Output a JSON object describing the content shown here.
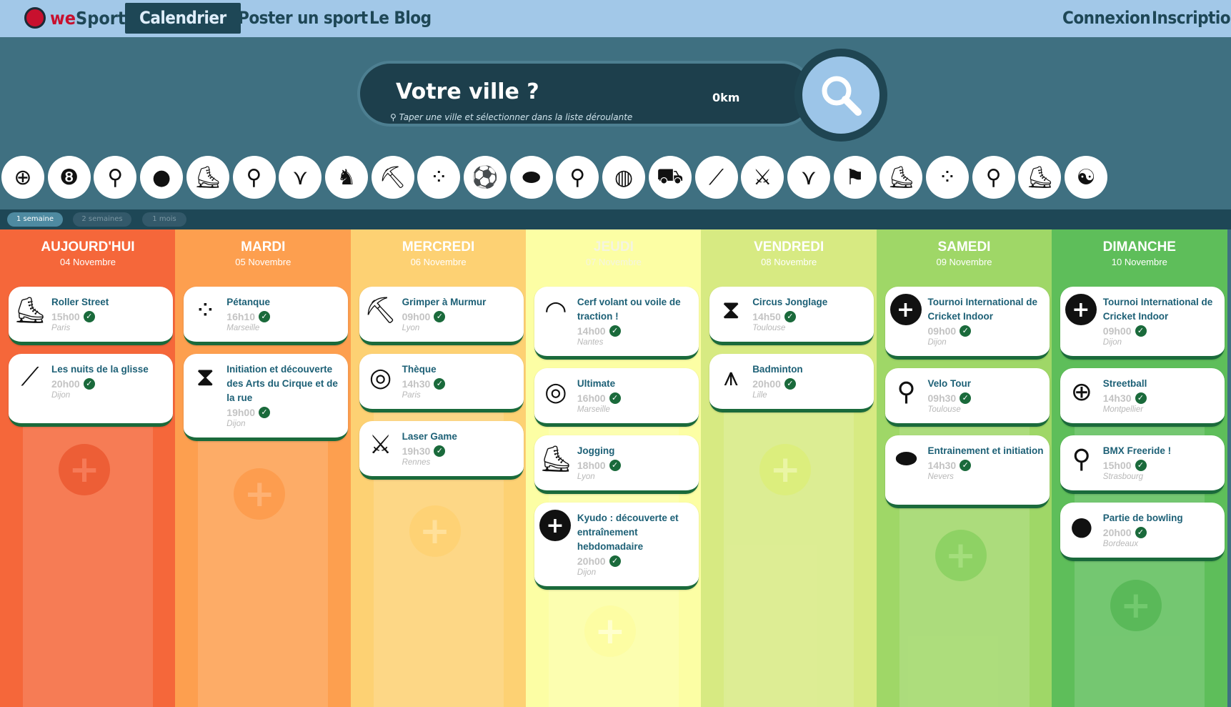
{
  "nav": {
    "brand_prefix": "we",
    "brand_suffix": "Sport",
    "links": [
      "Calendrier",
      "Poster un sport",
      "Le Blog"
    ],
    "login": "Connexion",
    "signup": "Inscription"
  },
  "search": {
    "title": "Votre ville ?",
    "hint": "Taper une ville et sélectionner dans la liste déroulante",
    "distance": "0km"
  },
  "sports_icons": [
    "basketball-icon",
    "billiard-8-ball-icon",
    "bmx-icon",
    "bowling-icon",
    "running-shoe-icon",
    "cycling-icon",
    "diving-fins-icon",
    "horse-riding-icon",
    "climbing-icon",
    "petanque-icon",
    "soccer-icon",
    "rugby-icon",
    "lollipop-icon",
    "volleyball-icon",
    "kart-icon",
    "fencing-icon",
    "laser-game-icon",
    "swim-fins-icon",
    "kitesurf-icon",
    "ice-skate-icon",
    "juggling-balls-icon",
    "table-tennis-icon",
    "sneaker-icon",
    "yin-yang-icon"
  ],
  "periods": [
    "1 semaine",
    "2 semaines",
    "1 mois"
  ],
  "days": [
    {
      "name": "AUJOURD'HUI",
      "date": "04 Novembre",
      "color": "#f5673a",
      "events": [
        {
          "title": "Roller Street",
          "time": "15h00",
          "city": "Paris",
          "icon": "roller-skate-icon"
        },
        {
          "title": "Les nuits de la glisse",
          "time": "20h00",
          "city": "Dijon",
          "icon": "skateboard-icon"
        }
      ]
    },
    {
      "name": "MARDI",
      "date": "05 Novembre",
      "color": "#fd9f4f",
      "events": [
        {
          "title": "Pétanque",
          "time": "16h10",
          "city": "Marseille",
          "icon": "petanque-icon"
        },
        {
          "title": "Initiation et découverte des Arts du Cirque et de la rue",
          "time": "19h00",
          "city": "Dijon",
          "icon": "diabolo-icon"
        }
      ]
    },
    {
      "name": "MERCREDI",
      "date": "06 Novembre",
      "color": "#fdd173",
      "events": [
        {
          "title": "Grimper à Murmur",
          "time": "09h00",
          "city": "Lyon",
          "icon": "ice-axe-icon"
        },
        {
          "title": "Thèque",
          "time": "14h30",
          "city": "Paris",
          "icon": "baseball-icon"
        },
        {
          "title": "Laser Game",
          "time": "19h30",
          "city": "Rennes",
          "icon": "laser-gun-icon"
        }
      ]
    },
    {
      "name": "JEUDI",
      "date": "07 Novembre",
      "color": "#fcfea4",
      "events": [
        {
          "title": "Cerf volant ou voile de traction !",
          "time": "14h00",
          "city": "Nantes",
          "icon": "kite-icon"
        },
        {
          "title": "Ultimate",
          "time": "16h00",
          "city": "Marseille",
          "icon": "frisbee-icon"
        },
        {
          "title": "Jogging",
          "time": "18h00",
          "city": "Lyon",
          "icon": "running-shoe-icon"
        },
        {
          "title": "Kyudo : découverte et entraînement hebdomadaire",
          "time": "20h00",
          "city": "Dijon",
          "icon": "plus-badge-icon"
        }
      ]
    },
    {
      "name": "VENDREDI",
      "date": "08 Novembre",
      "color": "#d7ea82",
      "events": [
        {
          "title": "Circus Jonglage",
          "time": "14h50",
          "city": "Toulouse",
          "icon": "diabolo-icon"
        },
        {
          "title": "Badminton",
          "time": "20h00",
          "city": "Lille",
          "icon": "shuttlecock-icon"
        }
      ]
    },
    {
      "name": "SAMEDI",
      "date": "09 Novembre",
      "color": "#9fd767",
      "events": [
        {
          "title": "Tournoi International de Cricket Indoor",
          "time": "09h00",
          "city": "Dijon",
          "icon": "plus-badge-icon"
        },
        {
          "title": "Velo Tour",
          "time": "09h30",
          "city": "Toulouse",
          "icon": "bicycle-icon"
        },
        {
          "title": "Entrainement et initiation",
          "time": "14h30",
          "city": "Nevers",
          "icon": "rugby-ball-icon"
        }
      ]
    },
    {
      "name": "DIMANCHE",
      "date": "10 Novembre",
      "color": "#5ebe5a",
      "events": [
        {
          "title": "Tournoi International de Cricket Indoor",
          "time": "09h00",
          "city": "Dijon",
          "icon": "plus-badge-icon"
        },
        {
          "title": "Streetball",
          "time": "14h30",
          "city": "Montpellier",
          "icon": "basketball-icon"
        },
        {
          "title": "BMX Freeride !",
          "time": "15h00",
          "city": "Strasbourg",
          "icon": "bmx-icon"
        },
        {
          "title": "Partie de bowling",
          "time": "20h00",
          "city": "Bordeaux",
          "icon": "bowling-ball-icon"
        }
      ]
    }
  ]
}
